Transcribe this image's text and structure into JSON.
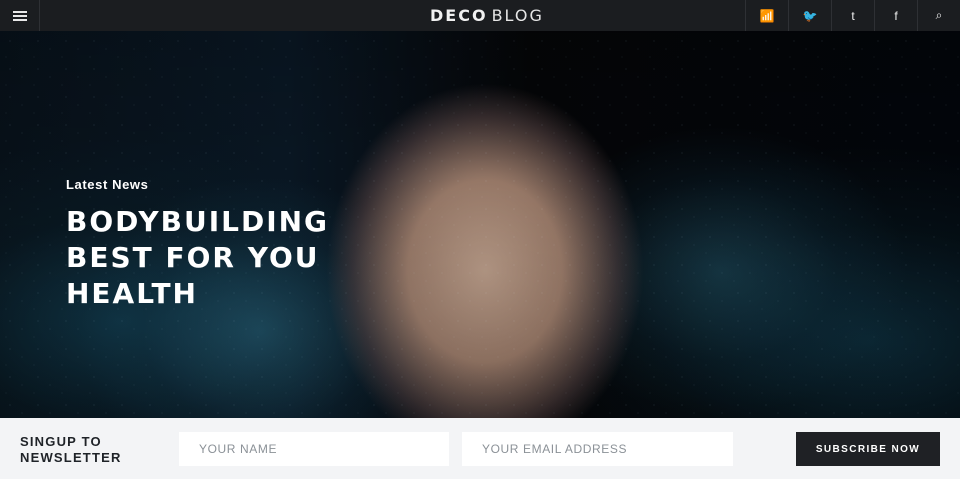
{
  "topbar": {
    "menu_icon": "menu-icon",
    "logo": {
      "left": "DECO",
      "right": "BLOG"
    },
    "social": [
      {
        "name": "wifi-icon",
        "glyph": "📶"
      },
      {
        "name": "twitter-icon",
        "glyph": "🐦"
      },
      {
        "name": "tumblr-icon",
        "glyph": "t"
      },
      {
        "name": "facebook-icon",
        "glyph": "f"
      },
      {
        "name": "search-icon",
        "glyph": "⌕"
      }
    ]
  },
  "hero": {
    "kicker": "Latest News",
    "headline": "BODYBUILDING BEST FOR YOU HEALTH"
  },
  "newsletter": {
    "title": "SINGUP TO NEWSLETTER",
    "name_placeholder": "YOUR NAME",
    "email_placeholder": "YOUR EMAIL ADDRESS",
    "subscribe_label": "SUBSCRIBE NOW"
  }
}
